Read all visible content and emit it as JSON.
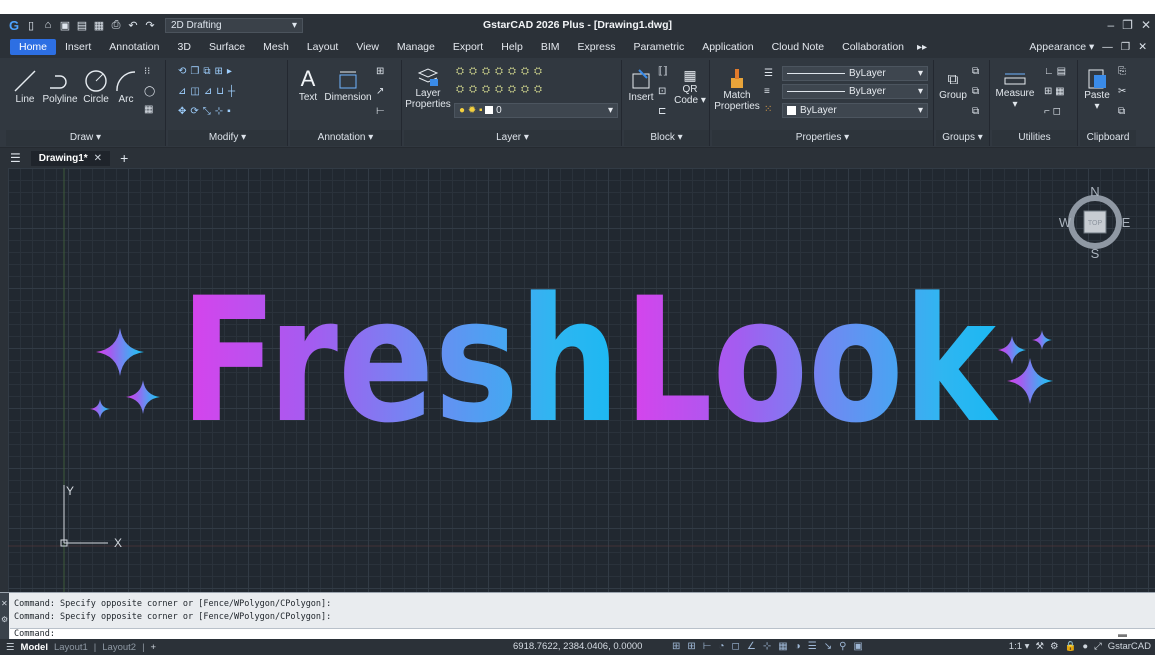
{
  "titlebar": {
    "workspace": "2D Drafting",
    "title": "GstarCAD 2026 Plus - [Drawing1.dwg]"
  },
  "menu": {
    "tabs": [
      "Home",
      "Insert",
      "Annotation",
      "3D",
      "Surface",
      "Mesh",
      "Layout",
      "View",
      "Manage",
      "Export",
      "Help",
      "BIM",
      "Express",
      "Parametric",
      "Application",
      "Cloud Note",
      "Collaboration"
    ],
    "appearance": "Appearance"
  },
  "ribbon": {
    "draw": {
      "title": "Draw",
      "line": "Line",
      "polyline": "Polyline",
      "circle": "Circle",
      "arc": "Arc"
    },
    "modify": {
      "title": "Modify"
    },
    "annotation": {
      "title": "Annotation",
      "text": "Text",
      "dimension": "Dimension"
    },
    "layer": {
      "title": "Layer",
      "properties_1": "Layer",
      "properties_2": "Properties",
      "current_layer": "0"
    },
    "block": {
      "title": "Block",
      "insert": "Insert",
      "qr_1": "QR",
      "qr_2": "Code"
    },
    "properties": {
      "title": "Properties",
      "match_1": "Match",
      "match_2": "Properties",
      "linetype": "ByLayer",
      "lineweight": "ByLayer",
      "color": "ByLayer"
    },
    "groups": {
      "title": "Groups",
      "group": "Group"
    },
    "utilities": {
      "title": "Utilities",
      "measure": "Measure"
    },
    "clipboard": {
      "title": "Clipboard",
      "paste": "Paste"
    }
  },
  "doc": {
    "tab": "Drawing1*"
  },
  "canvas": {
    "art_text_1": "Fresh",
    "art_text_2": "Look",
    "viewcube": {
      "n": "N",
      "s": "S",
      "e": "E",
      "w": "W",
      "top": "TOP"
    },
    "ucs": {
      "x": "X",
      "y": "Y"
    },
    "gradient": [
      "#d942ec",
      "#a45cf0",
      "#6e8af2",
      "#2fb6f1",
      "#1ab8f3"
    ]
  },
  "command": {
    "history": [
      "Command: Specify opposite corner or [Fence/WPolygon/CPolygon]:",
      "Command: Specify opposite corner or [Fence/WPolygon/CPolygon]:"
    ],
    "prompt": "Command:"
  },
  "status": {
    "model": "Model",
    "layout1": "Layout1",
    "layout2": "Layout2",
    "coords": "6918.7622, 2384.0406, 0.0000",
    "scale": "1:1",
    "app": "GstarCAD"
  }
}
